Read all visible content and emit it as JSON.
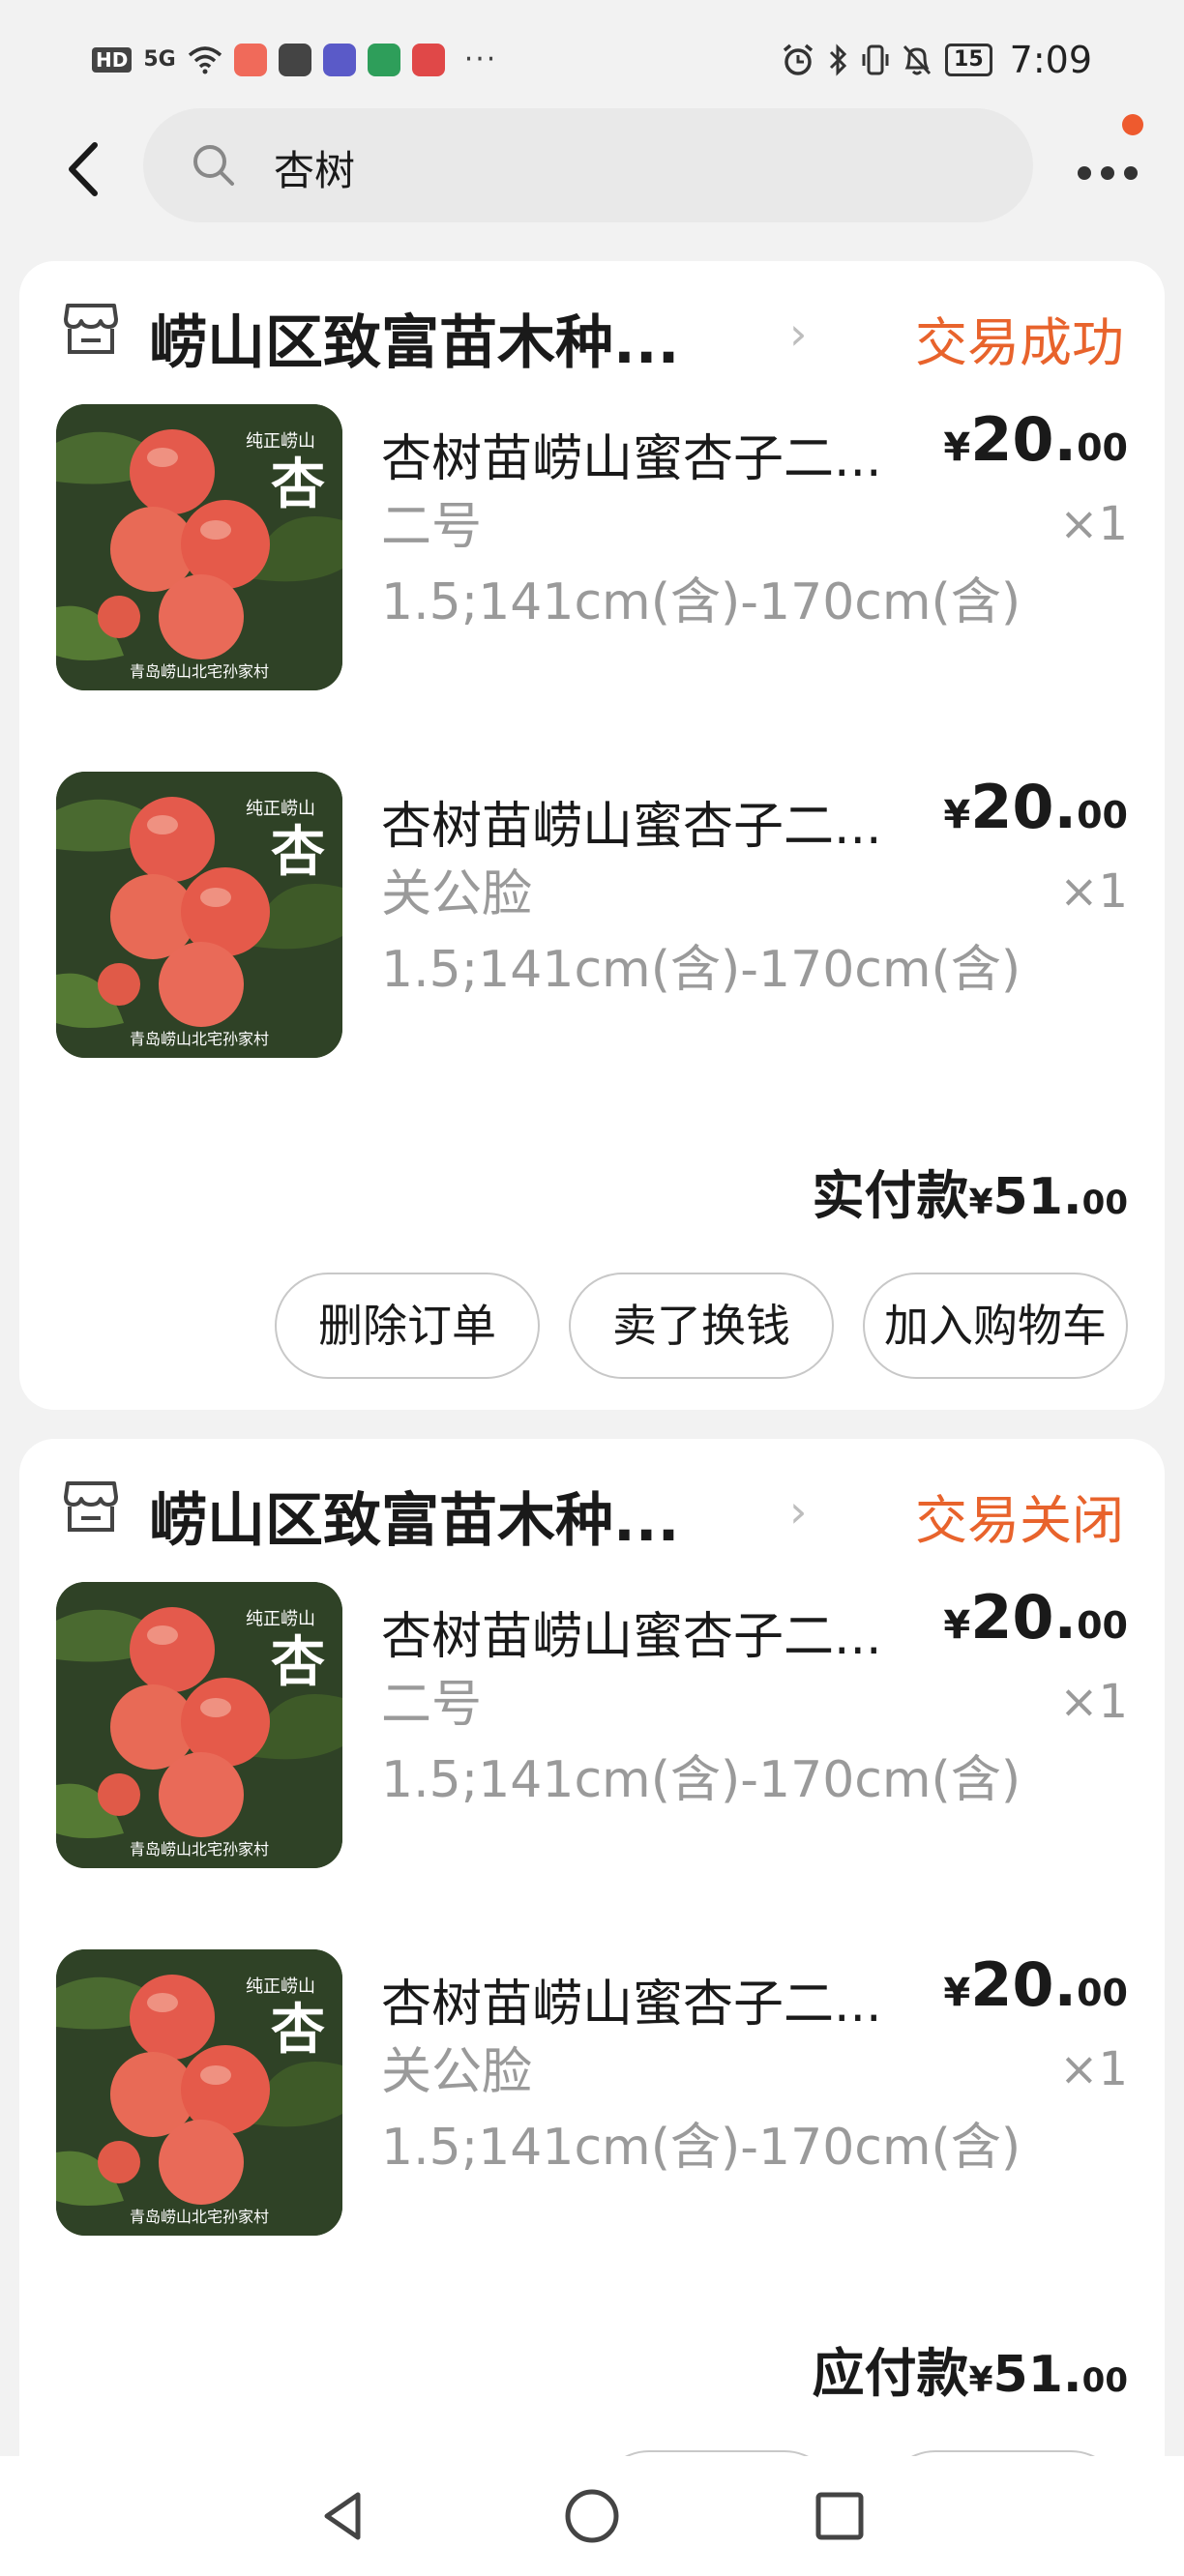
{
  "status_bar": {
    "hd": "HD",
    "signal": "5G",
    "time": "7:09",
    "battery": "15",
    "app_icon_colors": [
      "#f06a5a",
      "#444444",
      "#5a5ac8",
      "#2e9e5a",
      "#e04848"
    ],
    "overflow": "···"
  },
  "search": {
    "query": "杏树"
  },
  "orders": [
    {
      "shop_name": "崂山区致富苗木种...",
      "status": "交易成功",
      "items": [
        {
          "title": "杏树苗崂山蜜杏子二...",
          "variant": "二号",
          "spec": "1.5;141cm(含)-170cm(含)",
          "price_currency": "¥",
          "price_int": "20.",
          "price_dec": "00",
          "quantity": "×1",
          "image_caption_top": "纯正崂山",
          "image_char": "杏",
          "image_caption_bottom": "青岛崂山北宅孙家村"
        },
        {
          "title": "杏树苗崂山蜜杏子二...",
          "variant": "关公脸",
          "spec": "1.5;141cm(含)-170cm(含)",
          "price_currency": "¥",
          "price_int": "20.",
          "price_dec": "00",
          "quantity": "×1",
          "image_caption_top": "纯正崂山",
          "image_char": "杏",
          "image_caption_bottom": "青岛崂山北宅孙家村"
        }
      ],
      "total_label": "实付款",
      "total_currency": "¥",
      "total_int": "51.",
      "total_dec": "00",
      "actions": [
        "删除订单",
        "卖了换钱",
        "加入购物车"
      ]
    },
    {
      "shop_name": "崂山区致富苗木种...",
      "status": "交易关闭",
      "items": [
        {
          "title": "杏树苗崂山蜜杏子二...",
          "variant": "二号",
          "spec": "1.5;141cm(含)-170cm(含)",
          "price_currency": "¥",
          "price_int": "20.",
          "price_dec": "00",
          "quantity": "×1",
          "image_caption_top": "纯正崂山",
          "image_char": "杏",
          "image_caption_bottom": "青岛崂山北宅孙家村"
        },
        {
          "title": "杏树苗崂山蜜杏子二...",
          "variant": "关公脸",
          "spec": "1.5;141cm(含)-170cm(含)",
          "price_currency": "¥",
          "price_int": "20.",
          "price_dec": "00",
          "quantity": "×1",
          "image_caption_top": "纯正崂山",
          "image_char": "杏",
          "image_caption_bottom": "青岛崂山北宅孙家村"
        }
      ],
      "total_label": "应付款",
      "total_currency": "¥",
      "total_int": "51.",
      "total_dec": "00",
      "actions": []
    }
  ],
  "colors": {
    "accent": "#e8632c",
    "notification_dot": "#ee5a2e",
    "background": "#f2f2f2",
    "card": "#ffffff",
    "muted_text": "#9a9a9a"
  },
  "icons": {
    "back": "chevron-left-icon",
    "search": "search-icon",
    "more": "more-dots-icon",
    "shop": "shop-icon",
    "nav_back": "triangle-back-icon",
    "nav_home": "circle-home-icon",
    "nav_recents": "square-recents-icon"
  }
}
